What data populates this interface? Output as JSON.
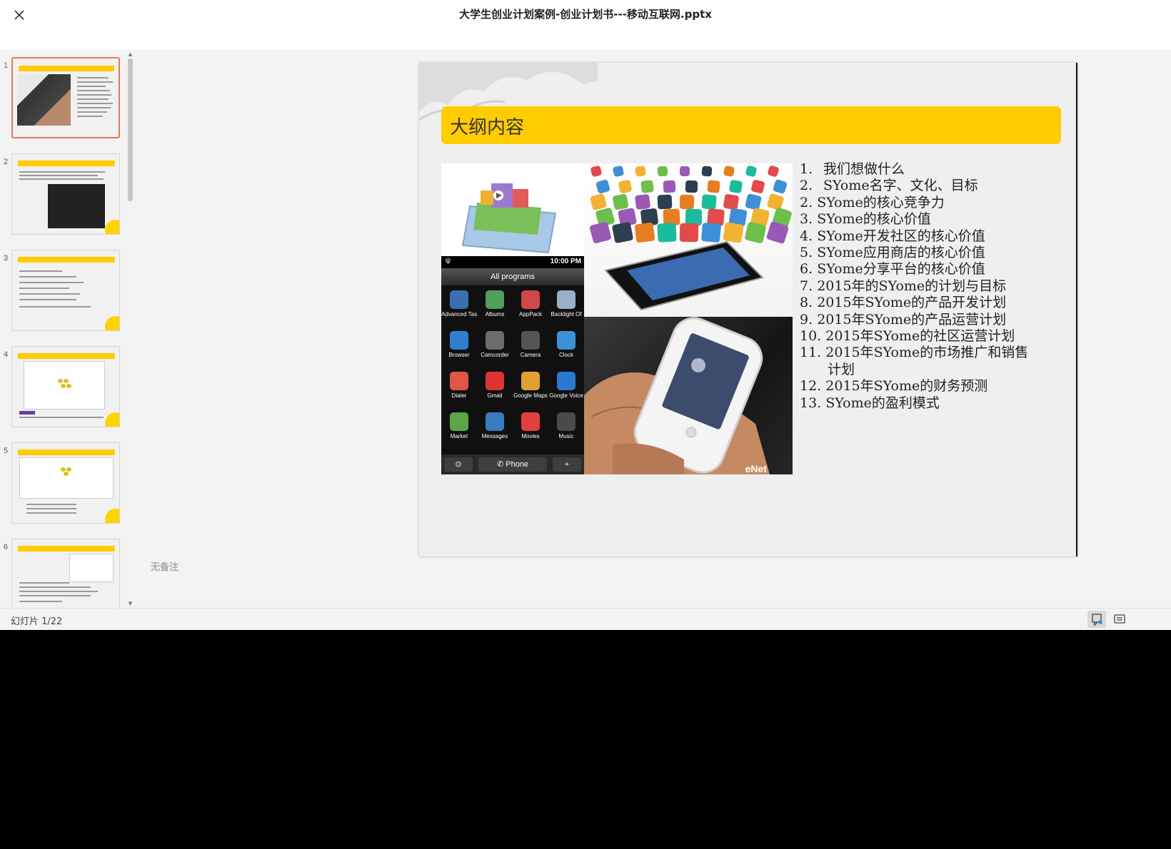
{
  "window": {
    "title": "大学生创业计划案例-创业计划书---移动互联网.pptx"
  },
  "icons": {
    "close": "close-icon",
    "notes_view": "notes-view-icon",
    "comments_view": "comments-view-icon"
  },
  "colors": {
    "banner": "#ffcc00",
    "active_thumb": "#e07b53"
  },
  "thumbnails": [
    {
      "num": "1",
      "active": true
    },
    {
      "num": "2",
      "active": false
    },
    {
      "num": "3",
      "active": false
    },
    {
      "num": "4",
      "active": false
    },
    {
      "num": "5",
      "active": false
    },
    {
      "num": "6",
      "active": false
    }
  ],
  "slide": {
    "title": "大纲内容",
    "android": {
      "time": "10:00 PM",
      "header": "All programs",
      "apps": [
        "Advanced Task Manag...",
        "Albums",
        "AppPack",
        "Backlight Of",
        "Browser",
        "Camcorder",
        "Camera",
        "Clock",
        "Dialer",
        "Gmail",
        "Google Maps",
        "Google Voice",
        "Market",
        "Messages",
        "Movies",
        "Music"
      ],
      "phone": "Phone"
    },
    "watermark": "eNet",
    "outline": [
      {
        "num": "1.",
        "text": "我们想做什么"
      },
      {
        "num": "2.",
        "text": "SYome名字、文化、目标"
      },
      {
        "num": "2.",
        "text": "SYome的核心竞争力"
      },
      {
        "num": "3.",
        "text": "SYome的核心价值"
      },
      {
        "num": "4.",
        "text": "SYome开发社区的核心价值"
      },
      {
        "num": "5.",
        "text": "SYome应用商店的核心价值"
      },
      {
        "num": "6.",
        "text": "SYome分享平台的核心价值"
      },
      {
        "num": "7.",
        "text": "2015年的SYome的计划与目标"
      },
      {
        "num": "8.",
        "text": "2015年SYome的产品开发计划"
      },
      {
        "num": "9.",
        "text": "2015年SYome的产品运营计划"
      },
      {
        "num": "10.",
        "text": "2015年SYome的社区运营计划"
      },
      {
        "num": "11.",
        "text": "2015年SYome的市场推广和销售"
      },
      {
        "num": "",
        "text": "计划"
      },
      {
        "num": "12.",
        "text": "2015年SYome的财务预测"
      },
      {
        "num": "13.",
        "text": "SYome的盈利模式"
      }
    ]
  },
  "notes": {
    "placeholder": "无备注"
  },
  "status": {
    "slide_counter": "幻灯片 1/22"
  }
}
